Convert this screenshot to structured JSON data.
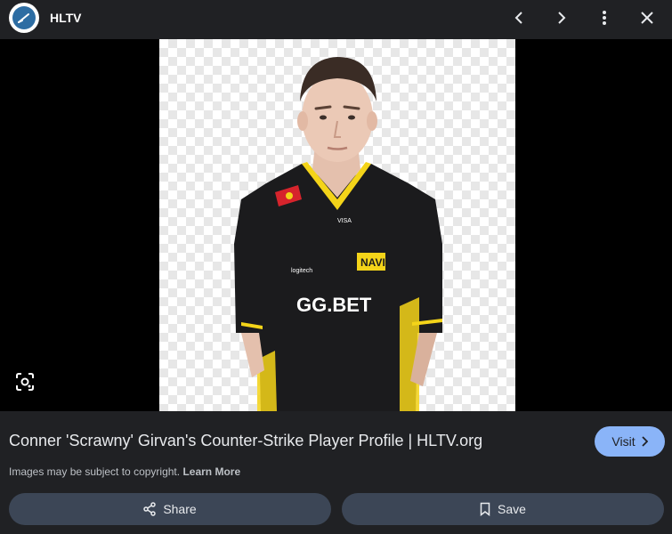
{
  "header": {
    "site_name": "HLTV",
    "logo_icon": "hltv-logo-icon",
    "buttons": [
      "chevron-left-icon",
      "chevron-right-icon",
      "more-vert-icon",
      "close-icon"
    ]
  },
  "viewer": {
    "jersey_text": {
      "sponsor": "GG.BET",
      "team": "NAVI",
      "logitech": "logitech",
      "visa": "VISA"
    },
    "lens_icon": "lens-search-icon"
  },
  "info": {
    "title": "Conner 'Scrawny' Girvan's Counter-Strike Player Profile | HLTV.org",
    "visit_label": "Visit",
    "copyright_text": "Images may be subject to copyright.",
    "learn_more": "Learn More"
  },
  "actions": {
    "share_label": "Share",
    "save_label": "Save"
  },
  "colors": {
    "background": "#202124",
    "accent": "#8ab4f8",
    "button": "#3c4656",
    "jersey_yellow": "#f4d419"
  }
}
